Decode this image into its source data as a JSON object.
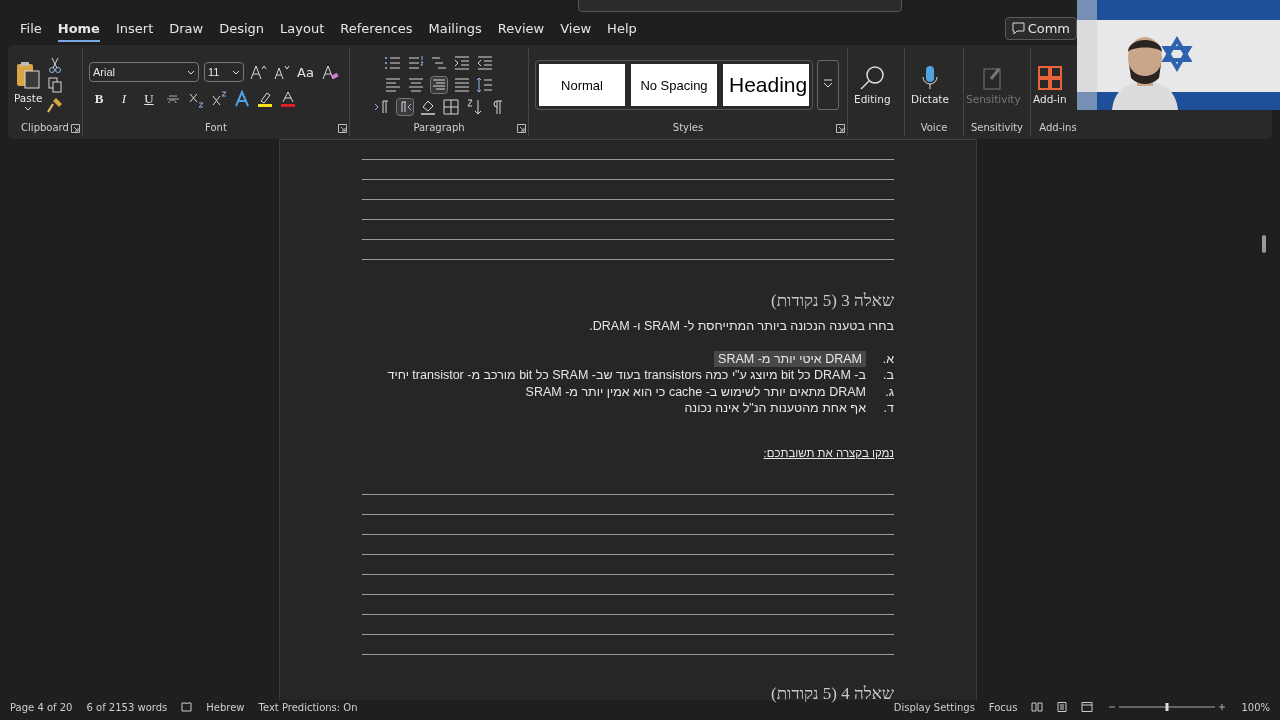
{
  "menu_tabs": [
    {
      "label": "File",
      "selected": false
    },
    {
      "label": "Home",
      "selected": true
    },
    {
      "label": "Insert",
      "selected": false
    },
    {
      "label": "Draw",
      "selected": false
    },
    {
      "label": "Design",
      "selected": false
    },
    {
      "label": "Layout",
      "selected": false
    },
    {
      "label": "References",
      "selected": false
    },
    {
      "label": "Mailings",
      "selected": false
    },
    {
      "label": "Review",
      "selected": false
    },
    {
      "label": "View",
      "selected": false
    },
    {
      "label": "Help",
      "selected": false
    }
  ],
  "comments_button": "Comm",
  "ribbon": {
    "clipboard": {
      "paste": "Paste",
      "label": "Clipboard"
    },
    "font": {
      "family": "Arial",
      "size": "11",
      "case_button": "Aa",
      "format_buttons": [
        "B",
        "I",
        "U"
      ],
      "label": "Font"
    },
    "paragraph": {
      "label": "Paragraph"
    },
    "styles": {
      "items": [
        {
          "name": "Normal",
          "kind": "normal"
        },
        {
          "name": "No Spacing",
          "kind": "normal"
        },
        {
          "name": "Heading",
          "kind": "heading"
        }
      ],
      "label": "Styles"
    },
    "editing": "Editing",
    "voice": {
      "button": "Dictate",
      "label": "Voice"
    },
    "sensitivity": {
      "button": "Sensitivity",
      "label": "Sensitivity",
      "disabled": true
    },
    "addins": {
      "button": "Add-in",
      "label": "Add-ins"
    }
  },
  "document": {
    "question_3": {
      "heading": "שאלה 3 (5 נקודות)",
      "prompt": "בחרו בטענה הנכונה ביותר המתייחסת ל- SRAM ו- DRAM.",
      "options": [
        {
          "letter": "א.",
          "text": "DRAM איטי יותר מ- SRAM",
          "highlighted": true
        },
        {
          "letter": "ב.",
          "text": "ב- DRAM כל bit מיוצג ע\"י כמה transistors בעוד שב- SRAM כל bit מורכב מ- transistor יחיד",
          "highlighted": false
        },
        {
          "letter": "ג.",
          "text": "DRAM מתאים יותר לשימוש ב- cache כי הוא אמין יותר מ- SRAM",
          "highlighted": false
        },
        {
          "letter": "ד.",
          "text": "אף אחת מהטענות הנ\"ל אינה נכונה",
          "highlighted": false
        }
      ],
      "explain": "נמקו בקצרה את תשובתכם:"
    },
    "question_4": {
      "heading": "שאלה 4 (5 נקודות)"
    }
  },
  "status_bar": {
    "page": "Page 4 of 20",
    "words": "6 of 2153 words",
    "language": "Hebrew",
    "predictions": "Text Predictions: On",
    "display": "Display Settings",
    "focus": "Focus",
    "zoom": "100%",
    "zoom_slider": {
      "level": 0.5
    }
  }
}
